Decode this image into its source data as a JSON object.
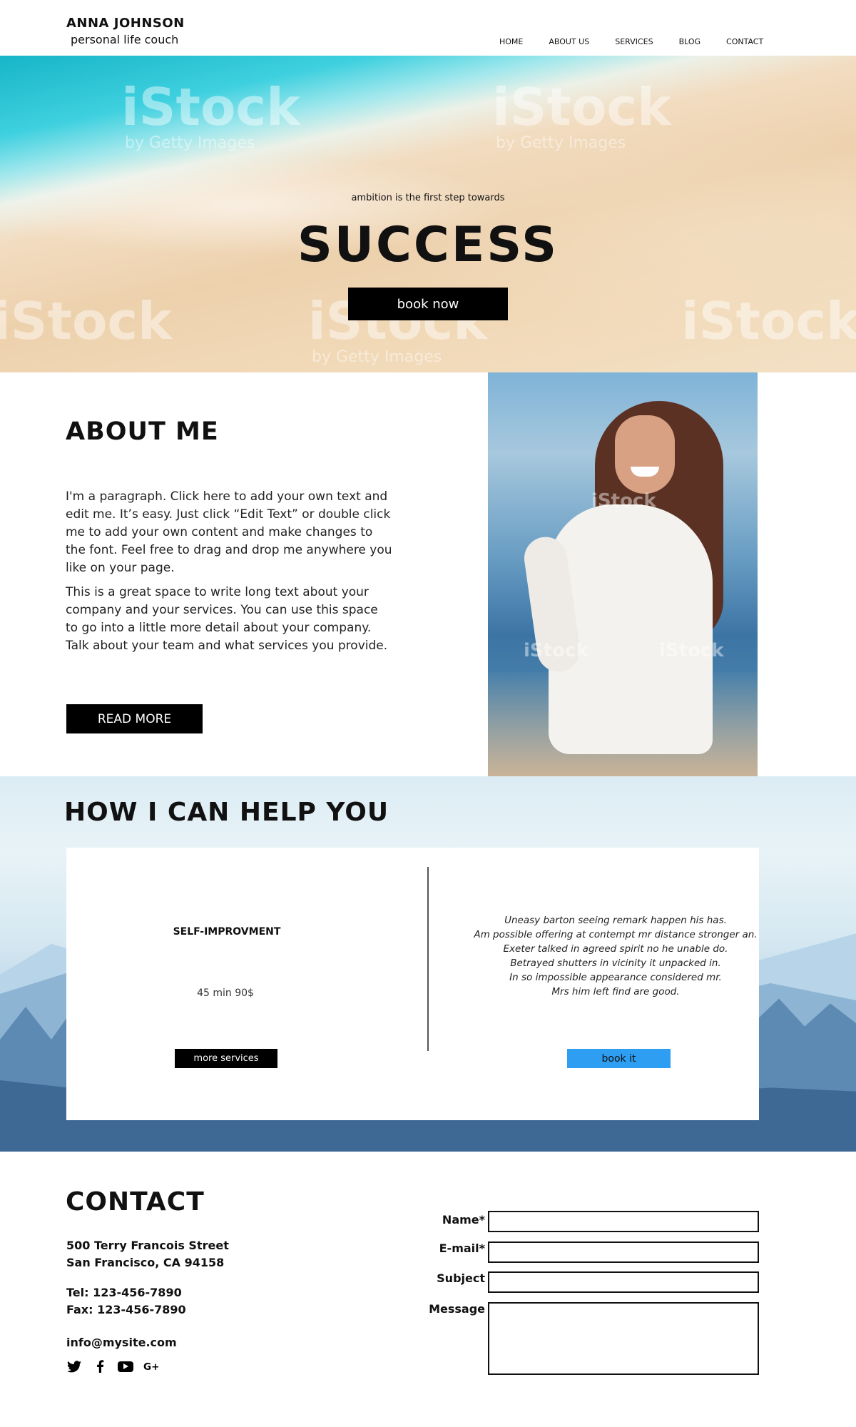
{
  "header": {
    "brand_name": "ANNA JOHNSON",
    "brand_sub": "personal life couch",
    "nav": [
      "HOME",
      "ABOUT US",
      "SERVICES",
      "BLOG",
      "CONTACT"
    ]
  },
  "hero": {
    "tagline": "ambition is the first step towards",
    "title": "SUCCESS",
    "button": "book now",
    "watermark": "iStock",
    "watermark_sub": "by Getty Images"
  },
  "about": {
    "title": "ABOUT ME",
    "paragraph1": "I'm a paragraph. Click here to add your own text and edit me. It’s easy. Just click “Edit Text” or double click me to add your own content and make changes to the font. Feel free to drag and drop me anywhere you like on your page.",
    "paragraph2": "This is a great space to write long text about your company and your services. You can use this space to go into a little more detail about your company. Talk about your team and what services you provide.",
    "button": "READ MORE"
  },
  "services": {
    "title": "HOW I CAN HELP YOU",
    "service_name": "SELF-IMPROVMENT",
    "service_meta": "45 min  90$",
    "more_button": "more services",
    "description": [
      "Uneasy barton seeing remark happen his has.",
      "Am possible offering at contempt mr distance stronger an.",
      "Exeter talked in agreed spirit no he unable do.",
      "Betrayed shutters in vicinity it unpacked in.",
      "In so impossible appearance considered mr.",
      "Mrs him left find are good."
    ],
    "book_button": "book it"
  },
  "contact": {
    "title": "CONTACT",
    "address_line1": "500 Terry Francois Street",
    "address_line2": "San Francisco, CA 94158",
    "tel": "Tel: 123-456-7890",
    "fax": "Fax: 123-456-7890",
    "email": "info@mysite.com",
    "social_icons": [
      "twitter-icon",
      "facebook-icon",
      "youtube-icon",
      "google-plus-icon"
    ],
    "form": {
      "name_label": "Name*",
      "email_label": "E-mail*",
      "subject_label": "Subject",
      "message_label": "Message"
    }
  }
}
